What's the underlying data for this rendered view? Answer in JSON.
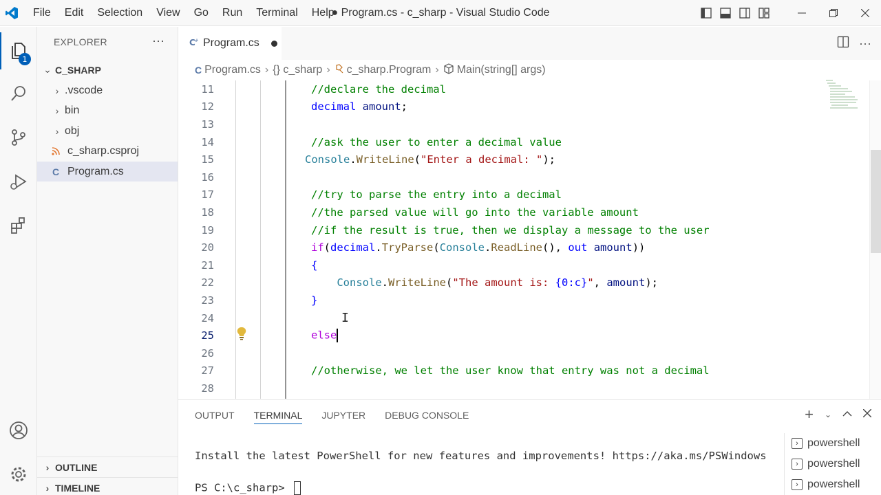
{
  "window": {
    "title": "● Program.cs - c_sharp - Visual Studio Code"
  },
  "menu": [
    "File",
    "Edit",
    "Selection",
    "View",
    "Go",
    "Run",
    "Terminal",
    "Help"
  ],
  "activity": {
    "explorer_badge": "1"
  },
  "sidebar": {
    "header": "EXPLORER",
    "more": "···",
    "root": "C_SHARP",
    "items": [
      {
        "label": ".vscode",
        "kind": "folder"
      },
      {
        "label": "bin",
        "kind": "folder"
      },
      {
        "label": "obj",
        "kind": "folder"
      },
      {
        "label": "c_sharp.csproj",
        "kind": "rss-file"
      },
      {
        "label": "Program.cs",
        "kind": "csharp-file",
        "selected": true
      }
    ],
    "outline": "OUTLINE",
    "timeline": "TIMELINE"
  },
  "tabs": [
    {
      "label": "Program.cs",
      "modified": true
    }
  ],
  "breadcrumb": [
    "Program.cs",
    "{} c_sharp",
    "c_sharp.Program",
    "Main(string[] args)"
  ],
  "editor": {
    "active_line": 25,
    "lines": [
      {
        "n": "11",
        "tokens": [
          {
            "t": "//declare the decimal",
            "c": "comment"
          }
        ]
      },
      {
        "n": "12",
        "tokens": [
          {
            "t": "decimal",
            "c": "kw"
          },
          {
            "t": " ",
            "c": "plain"
          },
          {
            "t": "amount",
            "c": "var"
          },
          {
            "t": ";",
            "c": "plain"
          }
        ]
      },
      {
        "n": "13",
        "tokens": []
      },
      {
        "n": "14",
        "tokens": [
          {
            "t": "//ask the user to enter a decimal value",
            "c": "comment"
          }
        ]
      },
      {
        "n": "15",
        "tokens": [
          {
            "t": "Console",
            "c": "type"
          },
          {
            "t": ".",
            "c": "plain"
          },
          {
            "t": "WriteLine",
            "c": "fn"
          },
          {
            "t": "(",
            "c": "plain"
          },
          {
            "t": "\"Enter a decimal: \"",
            "c": "str"
          },
          {
            "t": ");",
            "c": "plain"
          }
        ],
        "offset": -1
      },
      {
        "n": "16",
        "tokens": []
      },
      {
        "n": "17",
        "tokens": [
          {
            "t": "//try to parse the entry into a decimal",
            "c": "comment"
          }
        ]
      },
      {
        "n": "18",
        "tokens": [
          {
            "t": "//the parsed value will go into the variable amount",
            "c": "comment"
          }
        ]
      },
      {
        "n": "19",
        "tokens": [
          {
            "t": "//if the result is true, then we display a message to the user",
            "c": "comment"
          }
        ]
      },
      {
        "n": "20",
        "tokens": [
          {
            "t": "if",
            "c": "ctrl"
          },
          {
            "t": "(",
            "c": "plain"
          },
          {
            "t": "decimal",
            "c": "kw"
          },
          {
            "t": ".",
            "c": "plain"
          },
          {
            "t": "TryParse",
            "c": "fn"
          },
          {
            "t": "(",
            "c": "plain"
          },
          {
            "t": "Console",
            "c": "type"
          },
          {
            "t": ".",
            "c": "plain"
          },
          {
            "t": "ReadLine",
            "c": "fn"
          },
          {
            "t": "(), ",
            "c": "plain"
          },
          {
            "t": "out",
            "c": "kw"
          },
          {
            "t": " ",
            "c": "plain"
          },
          {
            "t": "amount",
            "c": "var"
          },
          {
            "t": "))",
            "c": "plain"
          }
        ]
      },
      {
        "n": "21",
        "tokens": [
          {
            "t": "{",
            "c": "kw"
          }
        ]
      },
      {
        "n": "22",
        "tokens": [
          {
            "t": "    ",
            "c": "plain"
          },
          {
            "t": "Console",
            "c": "type"
          },
          {
            "t": ".",
            "c": "plain"
          },
          {
            "t": "WriteLine",
            "c": "fn"
          },
          {
            "t": "(",
            "c": "plain"
          },
          {
            "t": "\"The amount is: ",
            "c": "str"
          },
          {
            "t": "{0:c}",
            "c": "kw"
          },
          {
            "t": "\"",
            "c": "str"
          },
          {
            "t": ", ",
            "c": "plain"
          },
          {
            "t": "amount",
            "c": "var"
          },
          {
            "t": ");",
            "c": "plain"
          }
        ]
      },
      {
        "n": "23",
        "tokens": [
          {
            "t": "}",
            "c": "kw"
          }
        ]
      },
      {
        "n": "24",
        "tokens": []
      },
      {
        "n": "25",
        "tokens": [
          {
            "t": "else",
            "c": "ctrl"
          }
        ],
        "caret": true
      },
      {
        "n": "26",
        "tokens": []
      },
      {
        "n": "27",
        "tokens": [
          {
            "t": "//otherwise, we let the user know that entry was not a decimal",
            "c": "comment"
          }
        ]
      },
      {
        "n": "28",
        "tokens": []
      }
    ]
  },
  "panel": {
    "tabs": [
      "OUTPUT",
      "TERMINAL",
      "JUPYTER",
      "DEBUG CONSOLE"
    ],
    "active_tab": "TERMINAL",
    "terminal_lines": [
      "Install the latest PowerShell for new features and improvements! https://aka.ms/PSWindows",
      "PS C:\\c_sharp> "
    ],
    "terminals": [
      "powershell",
      "powershell",
      "powershell"
    ]
  },
  "colors": {
    "accent": "#005fb8",
    "comment": "#008000",
    "keyword": "#0000ff",
    "control": "#af00db",
    "type": "#267f99",
    "function": "#795e26",
    "string": "#a31515",
    "variable": "#001080"
  }
}
